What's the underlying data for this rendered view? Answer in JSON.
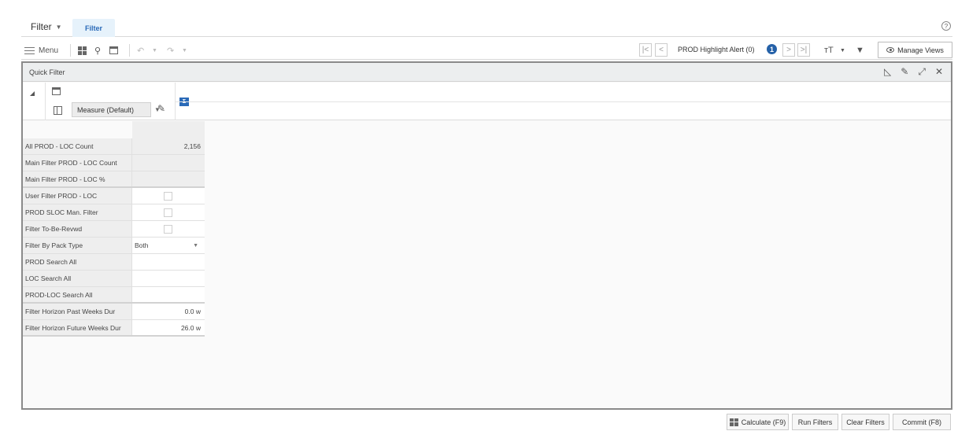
{
  "tabs": {
    "main_label": "Filter",
    "active_label": "Filter"
  },
  "toolbar": {
    "menu_label": "Menu",
    "alert_label": "PROD Highlight Alert (0)",
    "info_badge": "1",
    "manage_views_label": "Manage Views"
  },
  "quick_filter": {
    "title": "Quick Filter",
    "measure_label": "Measure (Default)"
  },
  "grid": {
    "rows": [
      {
        "label": "All PROD - LOC Count",
        "value": "2,156"
      },
      {
        "label": "Main Filter PROD - LOC Count",
        "value": ""
      },
      {
        "label": "Main Filter PROD - LOC %",
        "value": ""
      },
      {
        "label": "User Filter PROD - LOC",
        "checked": false
      },
      {
        "label": "PROD SLOC Man. Filter",
        "checked": false
      },
      {
        "label": "Filter To-Be-Revwd",
        "checked": false
      },
      {
        "label": "Filter By Pack Type",
        "value": "Both"
      },
      {
        "label": "PROD Search All",
        "value": ""
      },
      {
        "label": "LOC Search All",
        "value": ""
      },
      {
        "label": "PROD-LOC Search All",
        "value": ""
      },
      {
        "label": "Filter Horizon Past Weeks Dur",
        "value": "0.0 w"
      },
      {
        "label": "Filter Horizon Future Weeks Dur",
        "value": "26.0 w"
      }
    ]
  },
  "footer": {
    "calculate_label": "Calculate (F9)",
    "run_filters_label": "Run Filters",
    "clear_filters_label": "Clear Filters",
    "commit_label": "Commit (F8)"
  }
}
